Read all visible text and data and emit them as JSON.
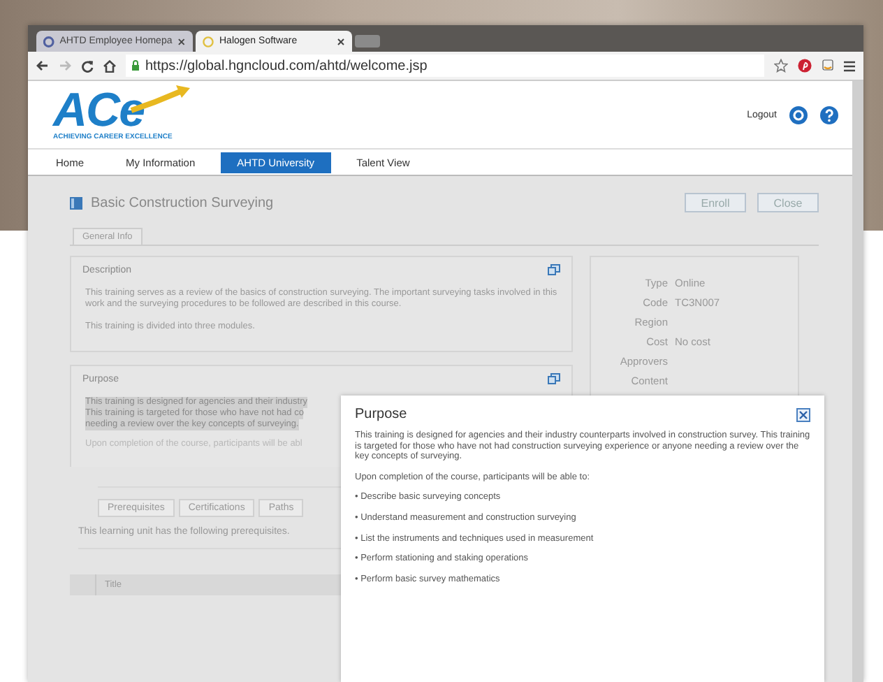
{
  "browser": {
    "tabs": [
      {
        "label": "AHTD Employee Homepa",
        "selected": false
      },
      {
        "label": "Halogen Software",
        "selected": true
      }
    ],
    "url": "https://global.hgncloud.com/ahtd/welcome.jsp"
  },
  "header": {
    "logo": "ACe",
    "tagline": "ACHIEVING CAREER EXCELLENCE",
    "logout": "Logout"
  },
  "nav": [
    {
      "label": "Home",
      "selected": false
    },
    {
      "label": "My Information",
      "selected": false
    },
    {
      "label": "AHTD University",
      "selected": true
    },
    {
      "label": "Talent View",
      "selected": false
    }
  ],
  "course": {
    "title": "Basic Construction Surveying",
    "buttons": [
      "Enroll",
      "Close"
    ],
    "tab": "General Info",
    "description": {
      "heading": "Description",
      "paragraphs": [
        "This training serves as a review of the basics of construction surveying. The important surveying tasks involved in this work and the surveying procedures to be followed are described in this course.",
        "This training is divided into three modules."
      ]
    },
    "purpose": {
      "heading": "Purpose",
      "lines": [
        "This training is designed for agencies and their industry",
        "This training is targeted for those who have not had co",
        "needing a review over the key concepts of surveying.",
        "Upon completion of the course, participants will be abl"
      ]
    },
    "details": [
      {
        "label": "Type",
        "value": "Online"
      },
      {
        "label": "Code",
        "value": "TC3N007"
      },
      {
        "label": "Region"
      },
      {
        "label": "Cost",
        "value": "No cost"
      },
      {
        "label": "Approvers"
      },
      {
        "label": "Content"
      }
    ],
    "lower_tabs": [
      "Prerequisites",
      "Certifications",
      "Paths"
    ],
    "prereq_text": "This learning unit has the following prerequisites.",
    "table": {
      "columns": [
        "Title"
      ]
    }
  },
  "popup": {
    "title": "Purpose",
    "paragraphs": [
      "This training is designed for agencies and their industry counterparts involved in construction survey. This training is targeted for those who have not had construction surveying experience or anyone needing a review over the key concepts of surveying.",
      "Upon completion of the course, participants will be able to:"
    ],
    "bullets": [
      "• Describe basic surveying concepts",
      "• Understand measurement and construction surveying",
      "• List the instruments and techniques used in measurement",
      "• Perform stationing and staking operations",
      "• Perform basic survey mathematics"
    ]
  }
}
